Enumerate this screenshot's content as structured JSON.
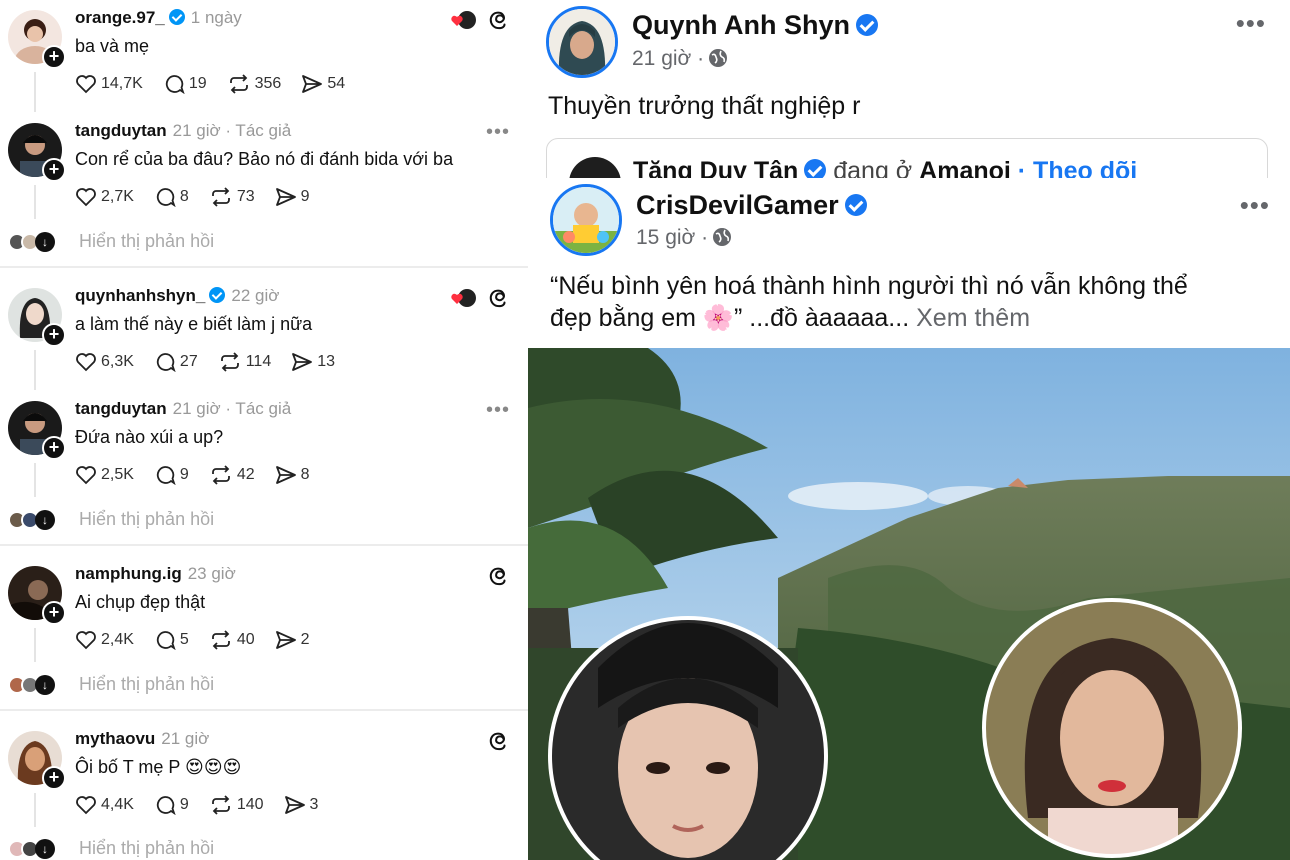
{
  "threads": {
    "comments": [
      {
        "username": "orange.97_",
        "verified": true,
        "time": "1 ngày",
        "author_tag": "",
        "text": "ba và mẹ",
        "likes": "14,7K",
        "comments": "19",
        "reposts": "356",
        "shares": "54",
        "replies_label": ""
      },
      {
        "username": "tangduytan",
        "verified": false,
        "time": "21 giờ",
        "author_tag": "· Tác giả",
        "text": "Con rể của ba đâu? Bảo nó đi đánh bida với ba",
        "likes": "2,7K",
        "comments": "8",
        "reposts": "73",
        "shares": "9",
        "replies_label": "Hiển thị phản hồi"
      },
      {
        "username": "quynhanhshyn_",
        "verified": true,
        "time": "22 giờ",
        "author_tag": "",
        "text": "a làm thế này e biết làm j nữa",
        "likes": "6,3K",
        "comments": "27",
        "reposts": "114",
        "shares": "13",
        "replies_label": ""
      },
      {
        "username": "tangduytan",
        "verified": false,
        "time": "21 giờ",
        "author_tag": "· Tác giả",
        "text": "Đứa nào xúi a up?",
        "likes": "2,5K",
        "comments": "9",
        "reposts": "42",
        "shares": "8",
        "replies_label": "Hiển thị phản hồi"
      },
      {
        "username": "namphung.ig",
        "verified": false,
        "time": "23 giờ",
        "author_tag": "",
        "text": "Ai chụp đẹp thật",
        "likes": "2,4K",
        "comments": "5",
        "reposts": "40",
        "shares": "2",
        "replies_label": "Hiển thị phản hồi"
      },
      {
        "username": "mythaovu",
        "verified": false,
        "time": "21 giờ",
        "author_tag": "",
        "text": "Ôi bố T mẹ P 😍😍😍",
        "likes": "4,4K",
        "comments": "9",
        "reposts": "140",
        "shares": "3",
        "replies_label": "Hiển thị phản hồi"
      }
    ]
  },
  "post1": {
    "name": "Quynh Anh Shyn",
    "time": "21 giờ ·",
    "text": "Thuyền trưởng thất nghiệp r",
    "shared_name": "Tăng Duy Tân",
    "shared_mid": " đang ở ",
    "shared_place": "Amanoi",
    "shared_follow": " · Theo dõi"
  },
  "post2": {
    "name": "CrisDevilGamer",
    "time": "15 giờ ·",
    "text_line1": "“Nếu bình yên hoá thành hình người thì nó vẫn không thể",
    "text_line2": "đẹp bằng em 🌸” ...đồ àaaaaa...",
    "see_more": "Xem thêm"
  },
  "colors": {
    "facebook_blue": "#1877f2",
    "threads_verified": "#0095f6",
    "muted": "#999999"
  },
  "icons": [
    "heart-icon",
    "comment-icon",
    "repost-icon",
    "share-icon",
    "threads-icon",
    "globe-icon",
    "more-icon",
    "verified-icon"
  ]
}
